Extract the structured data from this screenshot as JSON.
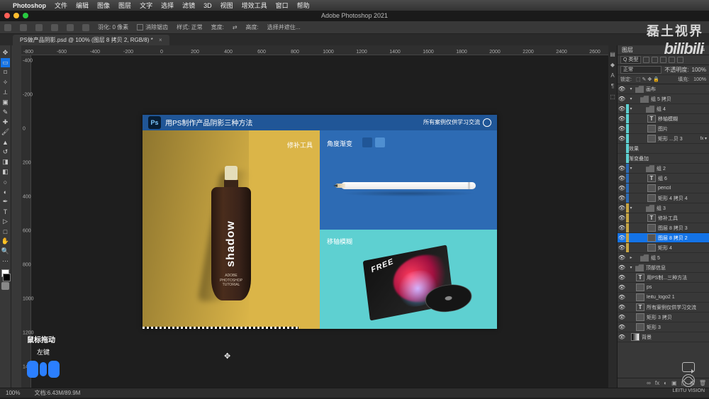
{
  "mac_menu": {
    "apple": "",
    "app": "Photoshop",
    "items": [
      "文件",
      "编辑",
      "图像",
      "图层",
      "文字",
      "选择",
      "滤镜",
      "3D",
      "视图",
      "增效工具",
      "窗口",
      "帮助"
    ]
  },
  "titlebar": "Adobe Photoshop 2021",
  "optbar": {
    "feather_label": "羽化:",
    "feather_val": "0 像素",
    "antialias": "消除锯齿",
    "style_label": "样式:",
    "style_val": "正常",
    "ratio_label": "宽度:",
    "ratio_sep": "⇄",
    "h_label": "高度:",
    "mask": "选择并遮住..."
  },
  "tab": {
    "title": "PS做产品阴影.psd @ 100% (图层 8 拷贝 2, RGB/8) *",
    "close": "×"
  },
  "ruler_ticks": [
    "-800",
    "-600",
    "-400",
    "-200",
    "0",
    "200",
    "400",
    "600",
    "800",
    "1000",
    "1200",
    "1400",
    "1600",
    "1800",
    "2000",
    "2200",
    "2400",
    "2600"
  ],
  "vticks": [
    "-400",
    "-200",
    "0",
    "200",
    "400",
    "600",
    "800",
    "1000",
    "1200",
    "1400"
  ],
  "canvas": {
    "header_title": "用PS制作产品阴影三种方法",
    "header_right": "所有案例仅供学习交流",
    "left_lbl": "修补工具",
    "bottle_txt": "shadow",
    "bottle_sub1": "ADOBE",
    "bottle_sub2": "PHOTOSHOP",
    "bottle_sub3": "TUTORIAL",
    "r1_lbl": "角度渐变",
    "r2_lbl": "移轴模糊",
    "cd_free": "FREE"
  },
  "panel": {
    "title": "图层",
    "kind": "Q 类型",
    "blend": "正常",
    "opacity_label": "不透明度:",
    "opacity": "100%",
    "lock_label": "锁定:",
    "fill_label": "填充:",
    "fill": "100%"
  },
  "layers": [
    {
      "d": 0,
      "eye": 1,
      "hl": "",
      "t": "folder",
      "arrow": "▾",
      "name": "画布"
    },
    {
      "d": 1,
      "eye": 1,
      "hl": "",
      "t": "folder",
      "arrow": "▾",
      "name": "组 5 拷贝"
    },
    {
      "d": 2,
      "eye": 1,
      "hl": "h-cyan",
      "t": "folder",
      "arrow": "▾",
      "name": "组 4"
    },
    {
      "d": 3,
      "eye": 1,
      "hl": "h-cyan",
      "t": "txt",
      "name": "移轴模糊",
      "txt": "T"
    },
    {
      "d": 3,
      "eye": 1,
      "hl": "h-cyan",
      "t": "img",
      "name": "图片"
    },
    {
      "d": 3,
      "eye": 1,
      "hl": "h-cyan",
      "t": "shape",
      "name": "矩形 ...贝 3",
      "fx": "fx ▾"
    },
    {
      "d": 4,
      "eye": 0,
      "hl": "h-cyan",
      "t": "",
      "name": "效果"
    },
    {
      "d": 4,
      "eye": 0,
      "hl": "h-cyan",
      "t": "",
      "name": "渐变叠加"
    },
    {
      "d": 2,
      "eye": 1,
      "hl": "h-blue",
      "t": "folder",
      "arrow": "▾",
      "name": "组 2"
    },
    {
      "d": 3,
      "eye": 1,
      "hl": "h-blue",
      "t": "txt",
      "name": "组 6",
      "txt": "T"
    },
    {
      "d": 3,
      "eye": 1,
      "hl": "h-blue",
      "t": "img",
      "name": "pencil"
    },
    {
      "d": 3,
      "eye": 1,
      "hl": "h-blue",
      "t": "shape",
      "name": "矩形 4 拷贝 4"
    },
    {
      "d": 2,
      "eye": 1,
      "hl": "h-yellow",
      "t": "folder",
      "arrow": "▾",
      "name": "组 3"
    },
    {
      "d": 3,
      "eye": 1,
      "hl": "h-yellow",
      "t": "txt",
      "name": "修补工具",
      "txt": "T"
    },
    {
      "d": 3,
      "eye": 1,
      "hl": "h-yellow",
      "t": "img",
      "name": "图层 8 拷贝 3"
    },
    {
      "d": 3,
      "eye": 1,
      "hl": "h-yellow",
      "t": "img",
      "name": "图层 8 拷贝 2",
      "sel": true
    },
    {
      "d": 3,
      "eye": 1,
      "hl": "h-yellow",
      "t": "shape",
      "name": "矩形 4"
    },
    {
      "d": 1,
      "eye": 1,
      "hl": "",
      "t": "folder",
      "arrow": "▸",
      "name": "组 5"
    },
    {
      "d": 0,
      "eye": 1,
      "hl": "",
      "t": "folder",
      "arrow": "▾",
      "name": "顶部信息"
    },
    {
      "d": 1,
      "eye": 1,
      "hl": "",
      "t": "txt",
      "name": "用PS制...三种方法",
      "txt": "T"
    },
    {
      "d": 1,
      "eye": 1,
      "hl": "",
      "t": "shape",
      "name": "ps"
    },
    {
      "d": 1,
      "eye": 1,
      "hl": "",
      "t": "img",
      "name": "leitu_logo2 1"
    },
    {
      "d": 1,
      "eye": 1,
      "hl": "",
      "t": "txt",
      "name": "所有案例仅供学习交流",
      "txt": "T"
    },
    {
      "d": 1,
      "eye": 1,
      "hl": "",
      "t": "shape",
      "name": "矩形 3 拷贝"
    },
    {
      "d": 1,
      "eye": 1,
      "hl": "",
      "t": "shape",
      "name": "矩形 3"
    },
    {
      "d": 0,
      "eye": 1,
      "hl": "",
      "t": "adj",
      "name": "背景"
    }
  ],
  "pfoot_icons": [
    "∞",
    "fx",
    "◐",
    "▣",
    "◻",
    "⊞",
    "🗑"
  ],
  "status": {
    "zoom": "100%",
    "doc": "文档:6.43M/89.9M"
  },
  "helper": {
    "title": "鼠标拖动",
    "sub": "左键"
  },
  "watermarks": {
    "a": "磊土视界",
    "b": "bilibili"
  },
  "br_label": "LEITU VISION"
}
